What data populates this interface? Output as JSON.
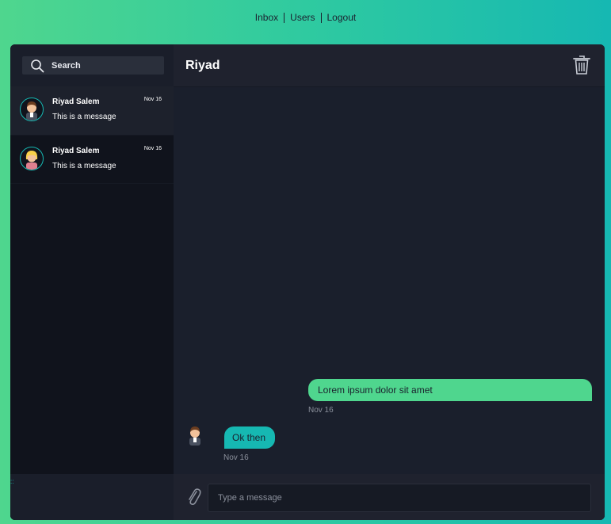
{
  "nav": {
    "inbox": "Inbox",
    "users": "Users",
    "logout": "Logout"
  },
  "search": {
    "label": "Search"
  },
  "conversations": [
    {
      "name": "Riyad Salem",
      "date": "Nov 16",
      "message": "This is a message",
      "avatar": "man-avatar-icon",
      "active": true
    },
    {
      "name": "Riyad Salem",
      "date": "Nov 16",
      "message": "This is a message",
      "avatar": "woman-avatar-icon",
      "active": false
    }
  ],
  "sidebar_footer": {
    "mark": "::"
  },
  "chat": {
    "title": "Riyad",
    "messages": [
      {
        "direction": "outgoing",
        "text": "Lorem ipsum dolor sit amet",
        "time": "Nov 16"
      },
      {
        "direction": "incoming",
        "text": "Ok then",
        "time": "Nov 16"
      }
    ]
  },
  "composer": {
    "placeholder": "Type a message"
  },
  "colors": {
    "accent_green": "#4fd68e",
    "accent_teal": "#16b8b2",
    "panel": "#1a1f2c",
    "sidebar": "#10131c"
  },
  "icons": {
    "search": "search-icon",
    "delete": "trash-icon",
    "attach": "paperclip-icon"
  }
}
